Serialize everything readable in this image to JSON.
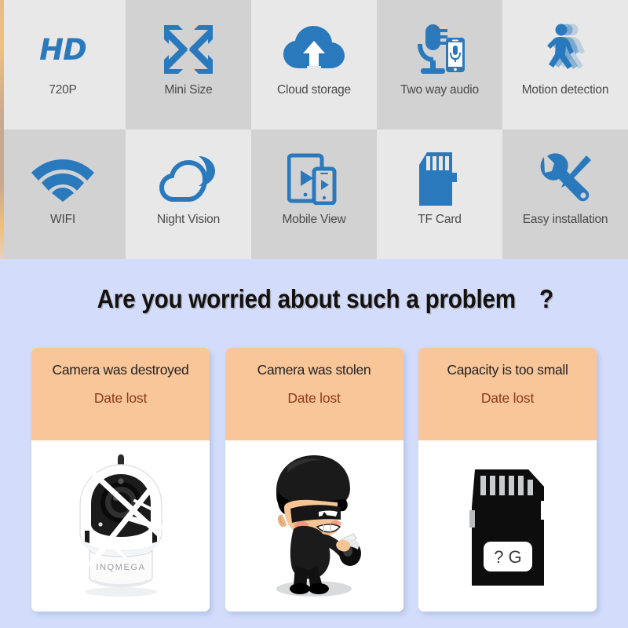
{
  "colors": {
    "icon_blue": "#2a79bd",
    "page_background_blue": "#d3ddfb",
    "tile_light": "#e8e8e8",
    "tile_dark": "#d2d2d2",
    "card_header_orange": "#f9c69a",
    "card_body_white": "#ffffff",
    "headline_black": "#14110f",
    "question_mark_blue": "#a8c4ef",
    "date_lost_brown": "#8c3b1b"
  },
  "features": {
    "rows": [
      [
        {
          "label": "720P",
          "icon": "hd-icon",
          "icon_text": "HD",
          "shade": "light"
        },
        {
          "label": "Mini Size",
          "icon": "minimize-arrows-icon",
          "shade": "dark"
        },
        {
          "label": "Cloud storage",
          "icon": "cloud-upload-icon",
          "shade": "light"
        },
        {
          "label": "Two way audio",
          "icon": "microphone-phone-icon",
          "shade": "dark"
        },
        {
          "label": "Motion detection",
          "icon": "walking-person-icon",
          "shade": "light"
        }
      ],
      [
        {
          "label": "WIFI",
          "icon": "wifi-icon",
          "shade": "dark"
        },
        {
          "label": "Night Vision",
          "icon": "cloud-moon-icon",
          "shade": "light"
        },
        {
          "label": "Mobile View",
          "icon": "tablet-phone-play-icon",
          "shade": "dark"
        },
        {
          "label": "TF Card",
          "icon": "sd-card-icon",
          "shade": "light"
        },
        {
          "label": "Easy installation",
          "icon": "wrench-screwdriver-icon",
          "shade": "dark"
        }
      ]
    ]
  },
  "headline": {
    "text": "Are you worried about such a problem",
    "question_mark": "?"
  },
  "problem_cards": [
    {
      "title": "Camera was destroyed",
      "subtitle": "Date lost",
      "image": "broken-security-camera-image",
      "brand_on_camera": "INQMEGA"
    },
    {
      "title": "Camera was stolen",
      "subtitle": "Date lost",
      "image": "burglar-thief-image"
    },
    {
      "title": "Capacity is too small",
      "subtitle": "Date lost",
      "image": "sd-card-image",
      "card_label": "? G"
    }
  ]
}
